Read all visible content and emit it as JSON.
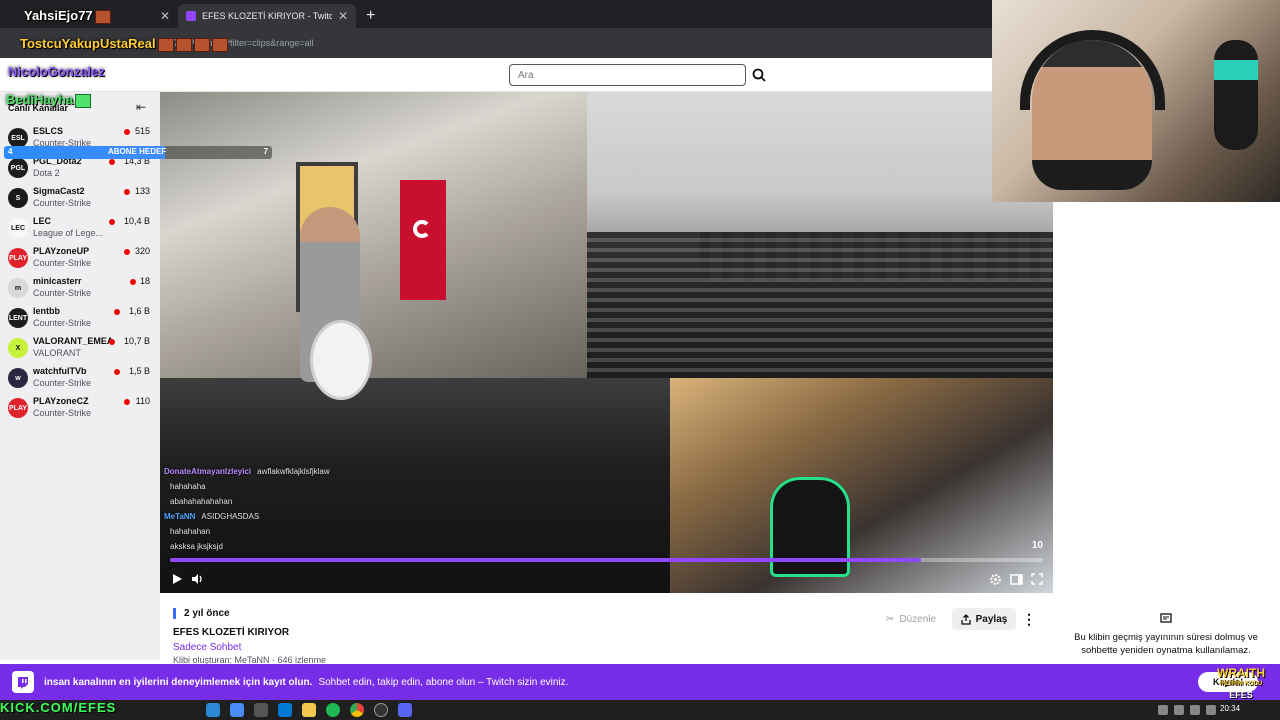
{
  "browser": {
    "tabs": [
      {
        "title": "",
        "active": false
      },
      {
        "title": "EFES KLOZETİ KIRIYOR - Twitch",
        "active": true
      }
    ],
    "url": "...A7__P-6amuL?filter=clips&range=all"
  },
  "header": {
    "search_placeholder": "Ara"
  },
  "sidebar": {
    "heading": "Canlı Kanallar",
    "channels": [
      {
        "name": "ESLCS",
        "game": "Counter-Strike",
        "viewers": "515",
        "avatar": "ESL",
        "color": "#1d1d1d"
      },
      {
        "name": "PGL_Dota2",
        "game": "Dota 2",
        "viewers": "14,3 B",
        "avatar": "PGL",
        "color": "#1d1d1d"
      },
      {
        "name": "SigmaCast2",
        "game": "Counter-Strike",
        "viewers": "133",
        "avatar": "S",
        "color": "#1a1a1a"
      },
      {
        "name": "LEC",
        "game": "League of Lege...",
        "viewers": "10,4 B",
        "avatar": "LEC",
        "color": "#f7f7f7"
      },
      {
        "name": "PLAYzoneUP",
        "game": "Counter-Strike",
        "viewers": "320",
        "avatar": "PLAY",
        "color": "#e0222b"
      },
      {
        "name": "minicasterr",
        "game": "Counter-Strike",
        "viewers": "18",
        "avatar": "m",
        "color": "#d9d9d9"
      },
      {
        "name": "lentbb",
        "game": "Counter-Strike",
        "viewers": "1,6 B",
        "avatar": "LENT",
        "color": "#1d1d1d"
      },
      {
        "name": "VALORANT_EMEA",
        "game": "VALORANT",
        "viewers": "10,7 B",
        "avatar": "X",
        "color": "#c7f23a"
      },
      {
        "name": "watchfulTVb",
        "game": "Counter-Strike",
        "viewers": "1,5 B",
        "avatar": "w",
        "color": "#2a2540"
      },
      {
        "name": "PLAYzoneCZ",
        "game": "Counter-Strike",
        "viewers": "110",
        "avatar": "PLAY",
        "color": "#e0222b"
      }
    ]
  },
  "player": {
    "time_label": "10",
    "progress": 0.86,
    "chat": [
      {
        "user": "DonateAtmayanIzleyici",
        "msg": "awflakwfklajklsfjklaw",
        "color": "#b58cff"
      },
      {
        "user": "",
        "msg": "hahahaha",
        "color": "#4fe36b"
      },
      {
        "user": "",
        "msg": "abahahahahahan",
        "color": "#ff79c6"
      },
      {
        "user": "MeTaNN",
        "msg": "ASIDGHASDAS",
        "color": "#4da3ff"
      },
      {
        "user": "",
        "msg": "hahahahan",
        "color": "#4fe36b"
      },
      {
        "user": "",
        "msg": "aksksa jksjksjd",
        "color": "#aaaaaa"
      }
    ]
  },
  "clip": {
    "age": "2 yıl önce",
    "title": "EFES KLOZETİ KIRIYOR",
    "category": "Sadece Sohbet",
    "creator_line": "Klibi oluşturan: MeTaNN · 646 izlenme",
    "edit_label": "Düzenle",
    "share_label": "Paylaş"
  },
  "expired": {
    "message": "Bu klibin geçmiş yayınının süresi dolmuş ve sohbette yeniden oynatma kullanılamaz."
  },
  "banner": {
    "main": "insan kanalının en iyilerini deneyimlemek için kayıt olun.",
    "sub": "Sohbet edin, takip edin, abone olun – Twitch sizin eviniz.",
    "signup_label": "Kaydol"
  },
  "taskbar": {
    "clock": "20:34"
  },
  "overlay": {
    "names": [
      {
        "text": "YahsiEjo77",
        "color": "#ffffff"
      },
      {
        "text": "TostcuYakupUstaReal",
        "color": "#ffcc33"
      },
      {
        "text": "NicoloGonzalez",
        "color": "#8c5cff"
      },
      {
        "text": "BediHayha",
        "color": "#4fe36b"
      }
    ],
    "goal": {
      "left": "4",
      "label": "ABONE HEDEF",
      "right": "7",
      "fraction": 0.6
    },
    "wraith_title": "WRAITH",
    "wraith_code_label": "İNDİRİM KODU",
    "wraith_code": "EFES",
    "bottom_text": "KICK.COM/EFES"
  }
}
